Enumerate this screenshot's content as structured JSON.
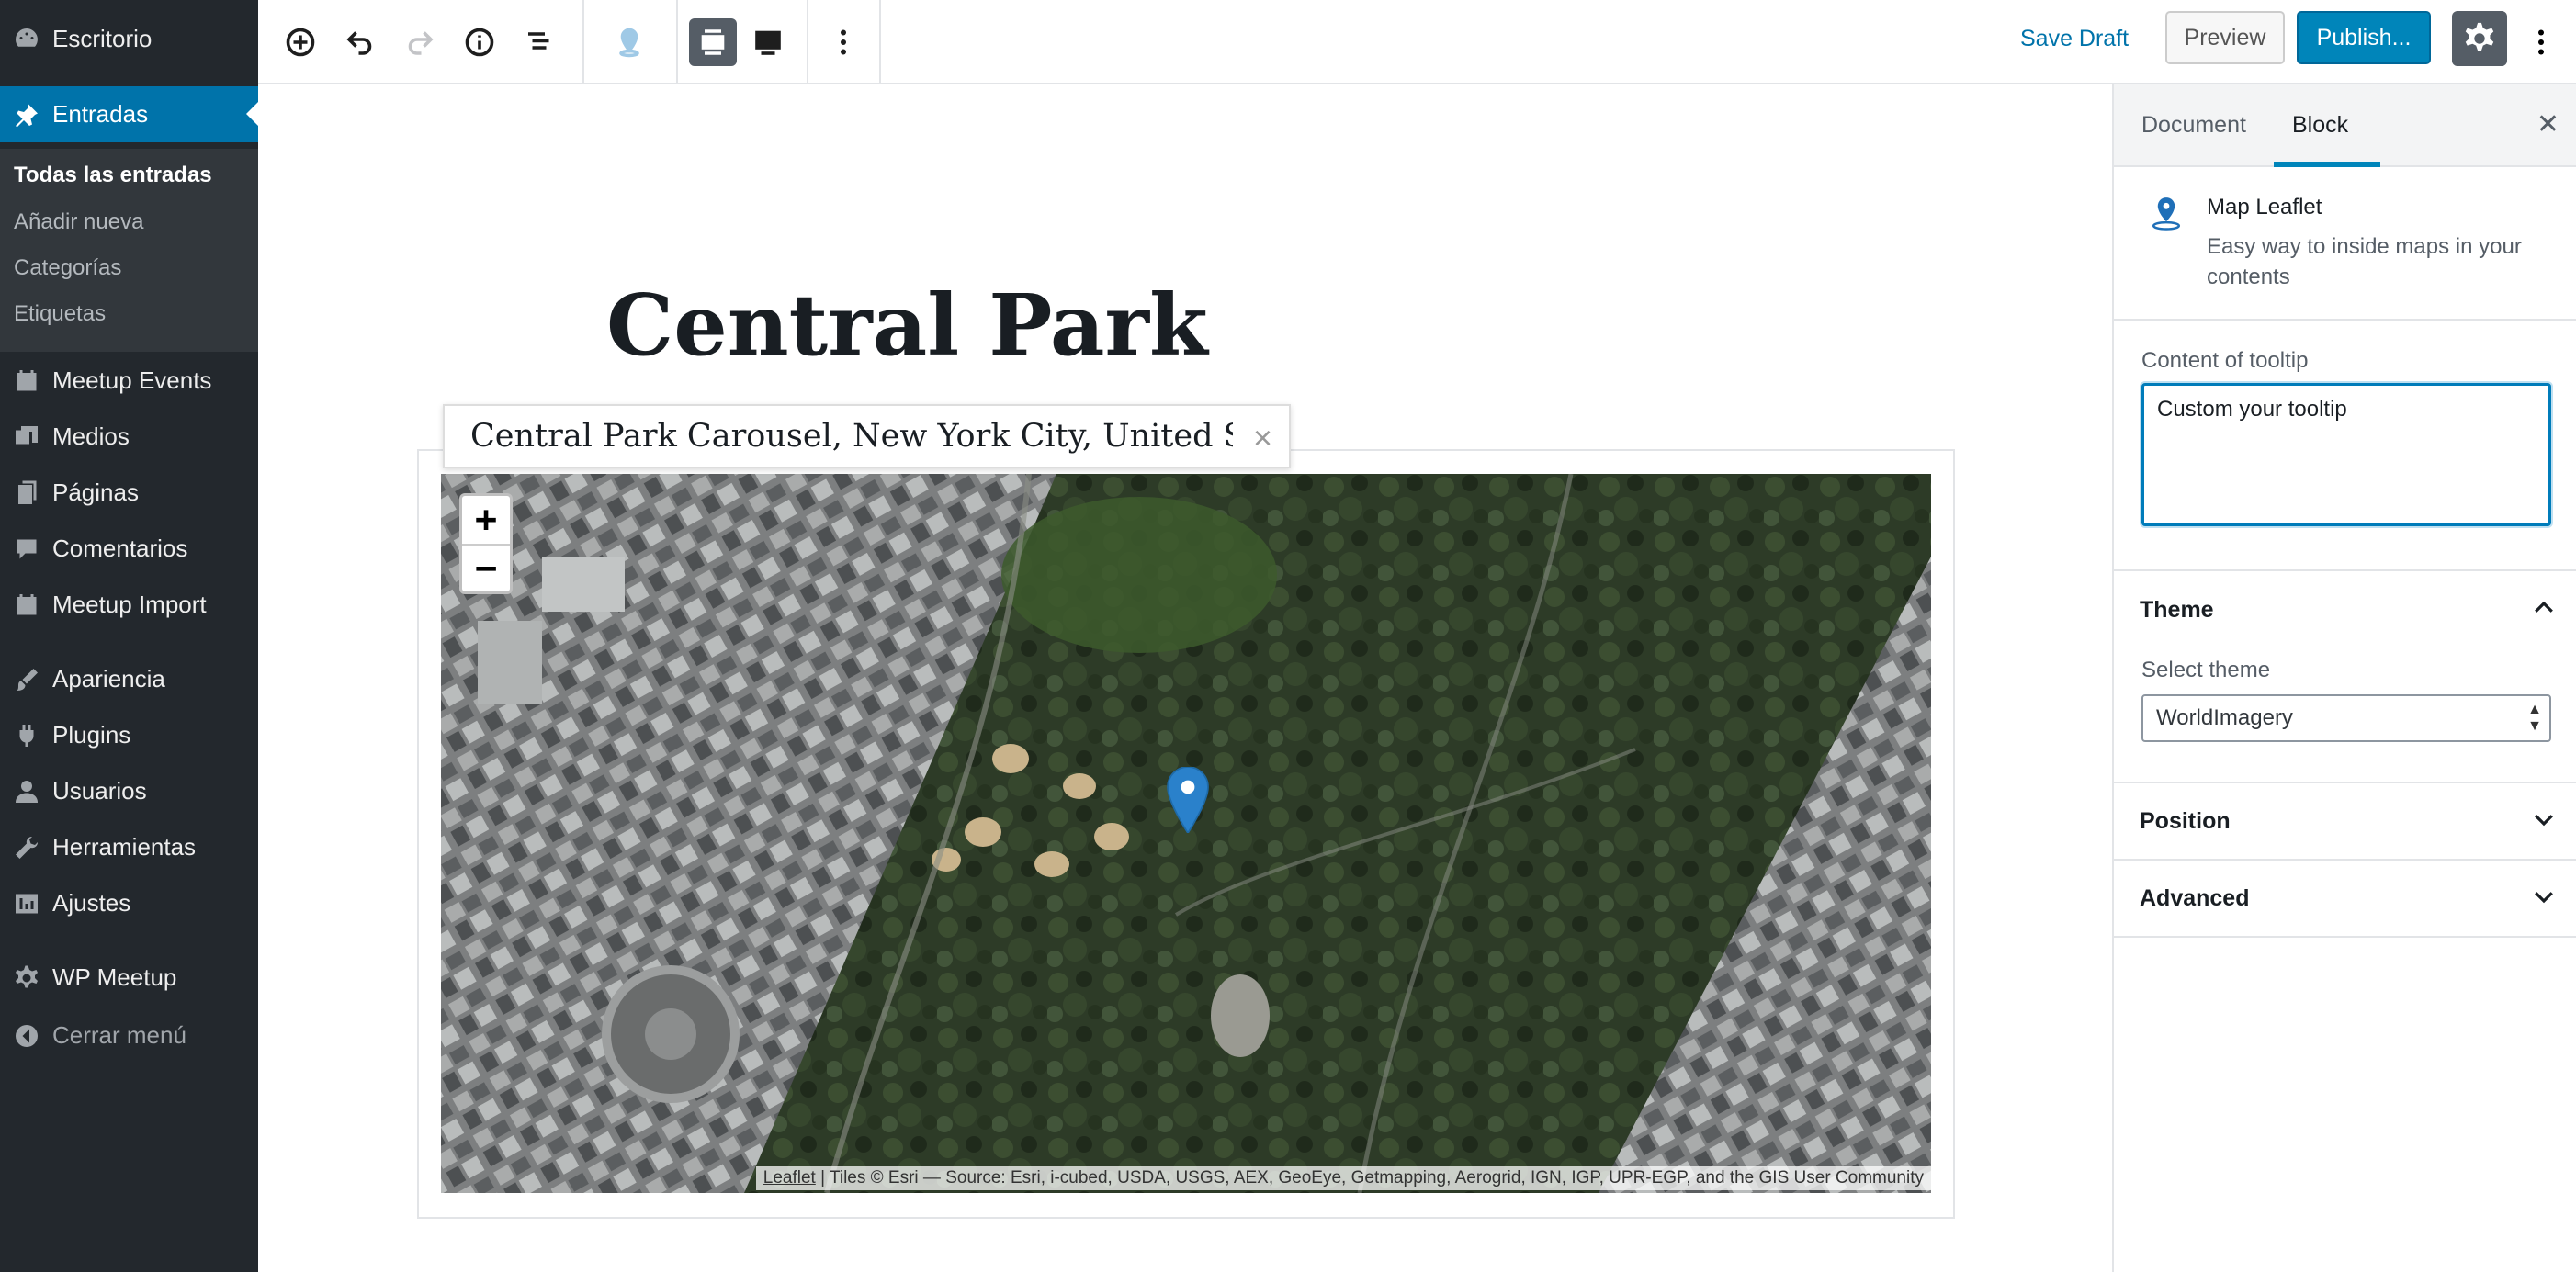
{
  "admin_menu": {
    "items": [
      {
        "label": "Escritorio",
        "icon": "dashboard-icon"
      },
      {
        "label": "Entradas",
        "icon": "pin-icon",
        "active": true
      },
      {
        "label": "Meetup Events",
        "icon": "calendar-icon"
      },
      {
        "label": "Medios",
        "icon": "media-icon"
      },
      {
        "label": "Páginas",
        "icon": "pages-icon"
      },
      {
        "label": "Comentarios",
        "icon": "comments-icon"
      },
      {
        "label": "Meetup Import",
        "icon": "calendar-icon"
      },
      {
        "label": "Apariencia",
        "icon": "appearance-icon"
      },
      {
        "label": "Plugins",
        "icon": "plugins-icon"
      },
      {
        "label": "Usuarios",
        "icon": "users-icon"
      },
      {
        "label": "Herramientas",
        "icon": "tools-icon"
      },
      {
        "label": "Ajustes",
        "icon": "settings-icon"
      },
      {
        "label": "WP Meetup",
        "icon": "gear-icon"
      },
      {
        "label": "Cerrar menú",
        "icon": "collapse-icon"
      }
    ],
    "submenu": [
      "Todas las entradas",
      "Añadir nueva",
      "Categorías",
      "Etiquetas"
    ]
  },
  "toolbar": {
    "save_draft": "Save Draft",
    "preview": "Preview",
    "publish": "Publish..."
  },
  "post": {
    "title": "Central Park"
  },
  "map_block": {
    "search_text": "Central Park Carousel, New York City, United Stat",
    "close_glyph": "×",
    "zoom_in": "+",
    "zoom_out": "−",
    "attribution_link": "Leaflet",
    "attribution_text": " | Tiles © Esri — Source: Esri, i-cubed, USDA, USGS, AEX, GeoEye, Getmapping, Aerogrid, IGN, IGP, UPR-EGP, and the GIS User Community",
    "marker_color": "#2a81cb"
  },
  "settings_panel": {
    "tabs": [
      "Document",
      "Block"
    ],
    "active_tab": "Block",
    "close_glyph": "✕",
    "block_title": "Map Leaflet",
    "block_description": "Easy way to inside maps in your contents",
    "tooltip_label": "Content of tooltip",
    "tooltip_value": "Custom your tooltip",
    "theme_section": "Theme",
    "theme_label": "Select theme",
    "theme_value": "WorldImagery",
    "position_section": "Position",
    "advanced_section": "Advanced"
  },
  "colors": {
    "admin_bg": "#23282d",
    "admin_active": "#0073aa",
    "primary": "#0085ba",
    "link": "#0073aa"
  }
}
